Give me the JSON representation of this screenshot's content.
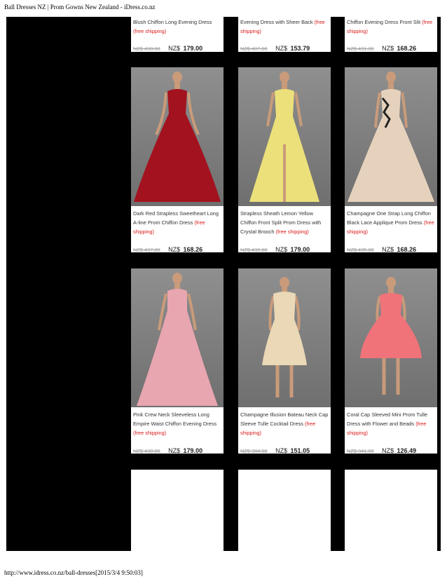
{
  "header": {
    "text": "Ball Dresses NZ | Prom Gowns New Zealand - iDress.co.nz"
  },
  "footer": {
    "text": "http://www.idress.co.nz/ball-dresses[2015/3/4 9:50:03]"
  },
  "products": [
    {
      "name": "Blush Chiffon Long Evening Dress",
      "shipping": "(free shipping)",
      "old_price": "NZ$ 430.00",
      "currency": "NZ$",
      "price": "179.00",
      "dress_color": "#e8b8b0"
    },
    {
      "name": "Evening Dress with Sheer Back",
      "shipping": "(free shipping)",
      "old_price": "NZ$ 407.00",
      "currency": "NZ$",
      "price": "153.79",
      "dress_color": "#cccccc"
    },
    {
      "name": "Chiffon Evening Dress Front Slit",
      "shipping": "(free shipping)",
      "old_price": "NZ$ 431.00",
      "currency": "NZ$",
      "price": "168.26",
      "dress_color": "#cccccc"
    },
    {
      "name": "Dark Red Strapless Sweetheart Long A-line Prom Chiffon Dress",
      "shipping": "(free shipping)",
      "old_price": "NZ$ 437.00",
      "currency": "NZ$",
      "price": "168.26",
      "dress_color": "#a3121f"
    },
    {
      "name": "Strapless Sheath Lemon Yellow Chiffon Front Split Prom Dress with Crystal Brooch",
      "shipping": "(free shipping)",
      "old_price": "NZ$ 432.00",
      "currency": "NZ$",
      "price": "179.00",
      "dress_color": "#ece07a"
    },
    {
      "name": "Champagne One Strap Long Chiffon Black Lace Applique Prom Dress",
      "shipping": "(free shipping)",
      "old_price": "NZ$ 435.00",
      "currency": "NZ$",
      "price": "168.26",
      "dress_color": "#e6d2bc"
    },
    {
      "name": "Pink Crew Neck Sleeveless Long Empire Waist Chiffon Evening Dress",
      "shipping": "(free shipping)",
      "old_price": "NZ$ 430.00",
      "currency": "NZ$",
      "price": "179.00",
      "dress_color": "#e8a6b0"
    },
    {
      "name": "Champagne Illusion Bateau Neck Cap Sleeve Tulle Cocktail Dress",
      "shipping": "(free shipping)",
      "old_price": "NZ$ 384.00",
      "currency": "NZ$",
      "price": "151.05",
      "dress_color": "#ead8b6"
    },
    {
      "name": "Coral Cap Sleeved Mini Prom Tulle Dress with Flower and Beads",
      "shipping": "(free shipping)",
      "old_price": "NZ$ 341.00",
      "currency": "NZ$",
      "price": "126.49",
      "dress_color": "#f0737a"
    }
  ]
}
